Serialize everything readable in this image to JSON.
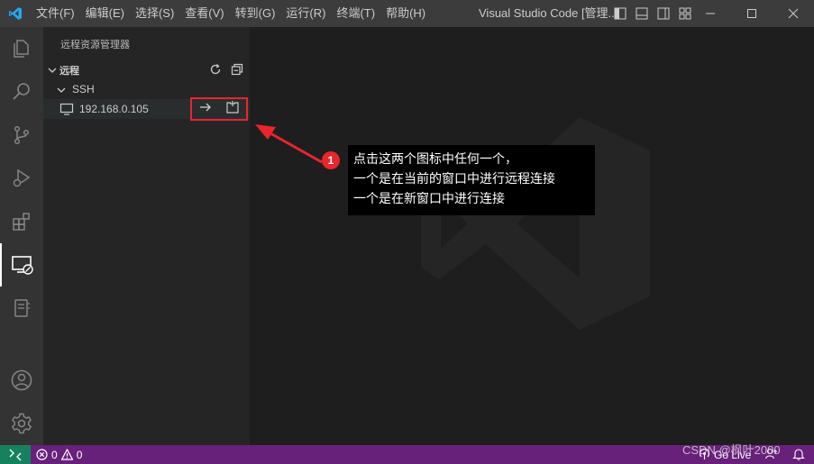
{
  "titlebar": {
    "menu": [
      "文件(F)",
      "编辑(E)",
      "选择(S)",
      "查看(V)",
      "转到(G)",
      "运行(R)",
      "终端(T)",
      "帮助(H)"
    ],
    "window_title": "Visual Studio Code [管理..."
  },
  "activitybar": {
    "items": [
      "files-icon",
      "search-icon",
      "source-control-icon",
      "run-debug-icon",
      "extensions-icon",
      "remote-explorer-icon",
      "notebook-icon",
      "account-icon",
      "settings-gear-icon"
    ],
    "active": "remote-explorer-icon"
  },
  "sidebar": {
    "title": "远程资源管理器",
    "section": {
      "label": "远程"
    },
    "group": {
      "label": "SSH"
    },
    "host": {
      "label": "192.168.0.105"
    }
  },
  "annotation": {
    "badge": "1",
    "lines": [
      "点击这两个图标中任何一个，",
      "一个是在当前的窗口中进行远程连接",
      "一个是在新窗口中进行连接"
    ]
  },
  "statusbar": {
    "errors": "0",
    "warnings": "0",
    "golive": "Go Live"
  },
  "watermark_text": "CSDN @枫叶2000",
  "colors": {
    "titlebar": "#3c3c3c",
    "activitybar": "#333333",
    "sidebar": "#252526",
    "editor": "#1e1e1e",
    "statusbar": "#68217a",
    "remote_indicator": "#16825d",
    "highlight": "#e8262c"
  }
}
